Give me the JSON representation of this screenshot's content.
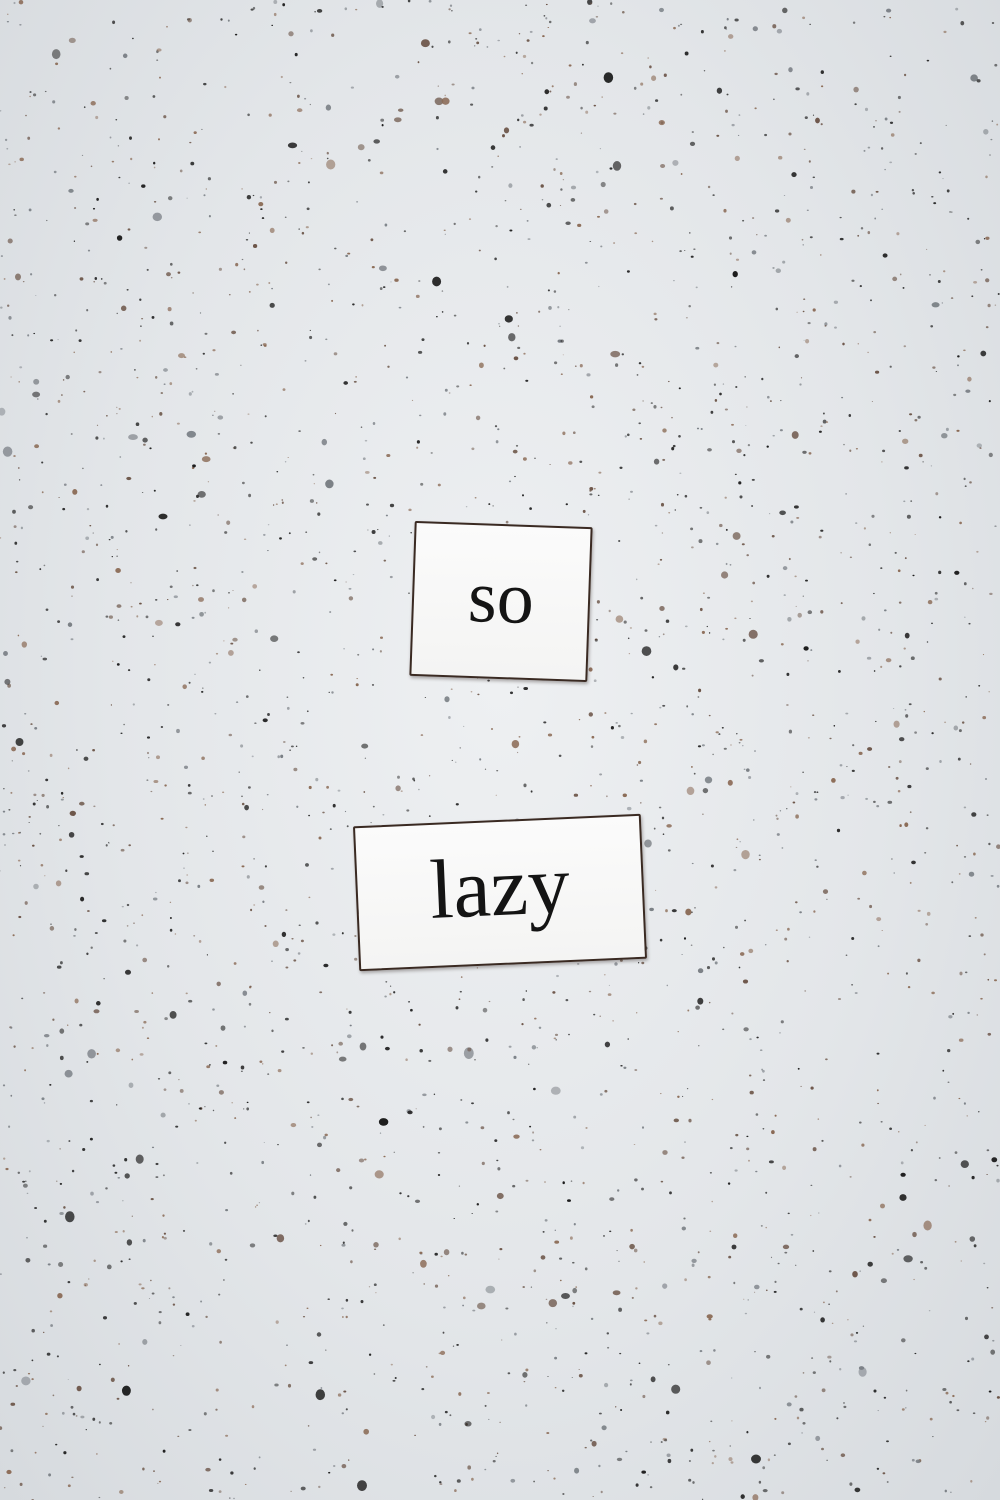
{
  "surface": {
    "base_color": "#e6e9ec",
    "speck_colors": [
      "#1a1a1a",
      "#2b2b2b",
      "#6b5447",
      "#8a6a55",
      "#7a7f85"
    ]
  },
  "magnets": [
    {
      "text": "so"
    },
    {
      "text": "lazy"
    }
  ]
}
